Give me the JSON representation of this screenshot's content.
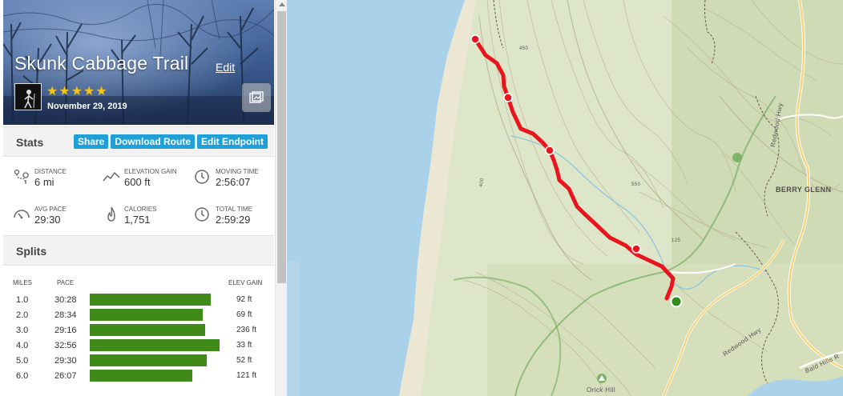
{
  "trail": {
    "title": "Skunk Cabbage Trail",
    "edit_label": "Edit",
    "rating": "★★★★★",
    "date": "November 29, 2019"
  },
  "stats": {
    "heading": "Stats",
    "buttons": {
      "share": "Share",
      "download": "Download Route",
      "edit_endpoint": "Edit Endpoint"
    },
    "items": [
      {
        "label": "DISTANCE",
        "value": "6 mi",
        "icon": "route-icon"
      },
      {
        "label": "ELEVATION GAIN",
        "value": "600 ft",
        "icon": "elevation-icon"
      },
      {
        "label": "MOVING TIME",
        "value": "2:56:07",
        "icon": "clock-icon"
      },
      {
        "label": "AVG PACE",
        "value": "29:30",
        "icon": "speedometer-icon"
      },
      {
        "label": "CALORIES",
        "value": "1,751",
        "icon": "flame-icon"
      },
      {
        "label": "TOTAL TIME",
        "value": "2:59:29",
        "icon": "clock-icon"
      }
    ]
  },
  "splits": {
    "heading": "Splits",
    "headers": {
      "miles": "MILES",
      "pace": "PACE",
      "elev": "ELEV GAIN"
    },
    "rows": [
      {
        "mile": "1.0",
        "pace": "30:28",
        "pace_fraction": 0.93,
        "elev": "92 ft"
      },
      {
        "mile": "2.0",
        "pace": "28:34",
        "pace_fraction": 0.87,
        "elev": "69 ft"
      },
      {
        "mile": "3.0",
        "pace": "29:16",
        "pace_fraction": 0.89,
        "elev": "236 ft"
      },
      {
        "mile": "4.0",
        "pace": "32:56",
        "pace_fraction": 1.0,
        "elev": "33 ft"
      },
      {
        "mile": "5.0",
        "pace": "29:30",
        "pace_fraction": 0.9,
        "elev": "52 ft"
      },
      {
        "mile": "6.0",
        "pace": "26:07",
        "pace_fraction": 0.79,
        "elev": "121 ft"
      }
    ],
    "bar_color": "#3f8a18"
  },
  "map": {
    "labels": {
      "place1": "BERRY GLENN",
      "place2": "Orick Hill",
      "road1": "Redwood Hwy",
      "road2": "Redwood Hwy",
      "road3": "Bald Hills R",
      "contour1": "450",
      "contour2": "550",
      "contour3": "400",
      "contour4": "125"
    },
    "route_color": "#e8141e",
    "end_marker_color": "#2f8f1a"
  }
}
